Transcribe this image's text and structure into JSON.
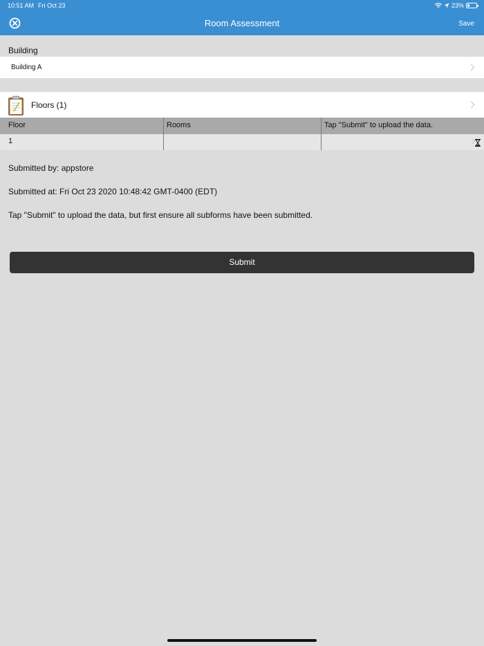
{
  "status_bar": {
    "time": "10:51 AM",
    "date": "Fri Oct 23",
    "battery": "23%",
    "battery_level": 0.23
  },
  "header": {
    "title": "Room Assessment",
    "save_label": "Save",
    "close_icon": "close-circle-icon"
  },
  "building": {
    "label": "Building",
    "value": "Building A"
  },
  "floors": {
    "label": "Floors (1)",
    "icon": "clipboard-icon",
    "columns": [
      "Floor",
      "Rooms",
      "Tap \"Submit\" to upload the data."
    ],
    "rows": [
      {
        "floor": "1",
        "rooms": "",
        "status": ""
      }
    ]
  },
  "info": {
    "submitted_by": "Submitted by: appstore",
    "submitted_at": "Submitted at: Fri Oct 23 2020 10:48:42 GMT-0400 (EDT)",
    "instructions": "Tap \"Submit\" to upload the data, but first ensure all subforms have been submitted."
  },
  "submit_label": "Submit",
  "colors": {
    "header_bg": "#3a8fd3",
    "page_bg": "#dcdcdc",
    "button_bg": "#333333"
  }
}
